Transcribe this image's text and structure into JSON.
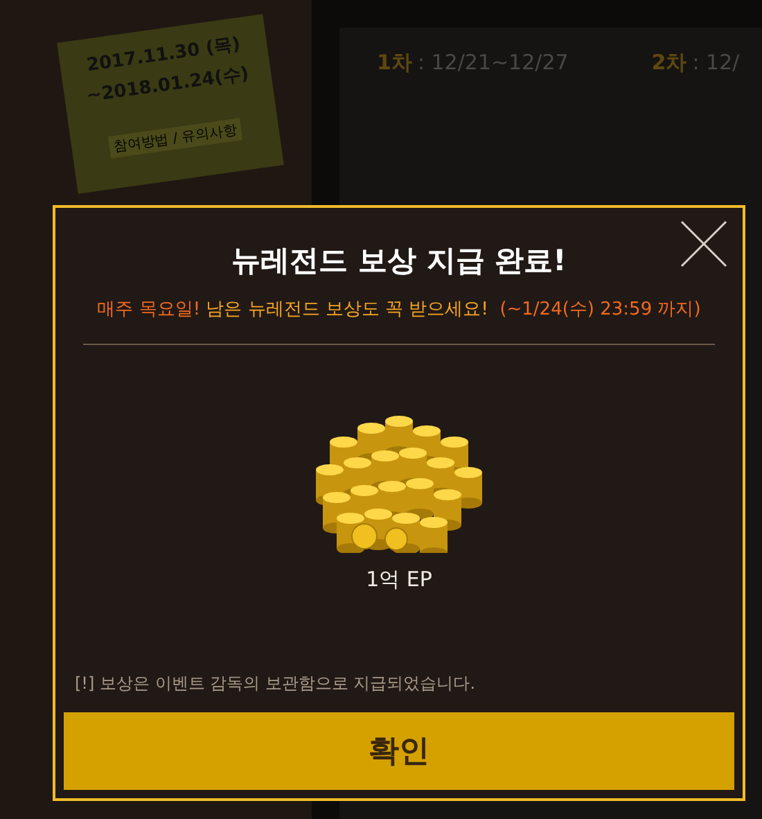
{
  "background": {
    "note": {
      "dates": [
        "2017.11.30 (목)",
        "~2018.01.24(수)"
      ],
      "link": "참여방법 / 유의사항"
    },
    "rounds": [
      {
        "label": "1차",
        "period": ": 12/21~12/27"
      },
      {
        "label": "2차",
        "period": ": 12/"
      }
    ]
  },
  "dialog": {
    "title": "뉴레전드 보상 지급 완료!",
    "subtitle": [
      {
        "text": "매주 목요일! ",
        "color": "#f06a1e"
      },
      {
        "text": "남은 뉴레전드 보상도 꼭 받으세요! ",
        "color": "#f5a623"
      },
      {
        "text": " (~1/24(수) 23:59 까지)",
        "color": "#f06a1e"
      }
    ],
    "reward": {
      "label": "1억 EP"
    },
    "notice": "[!] 보상은 이벤트 감독의 보관함으로 지급되었습니다.",
    "confirm": "확인"
  }
}
